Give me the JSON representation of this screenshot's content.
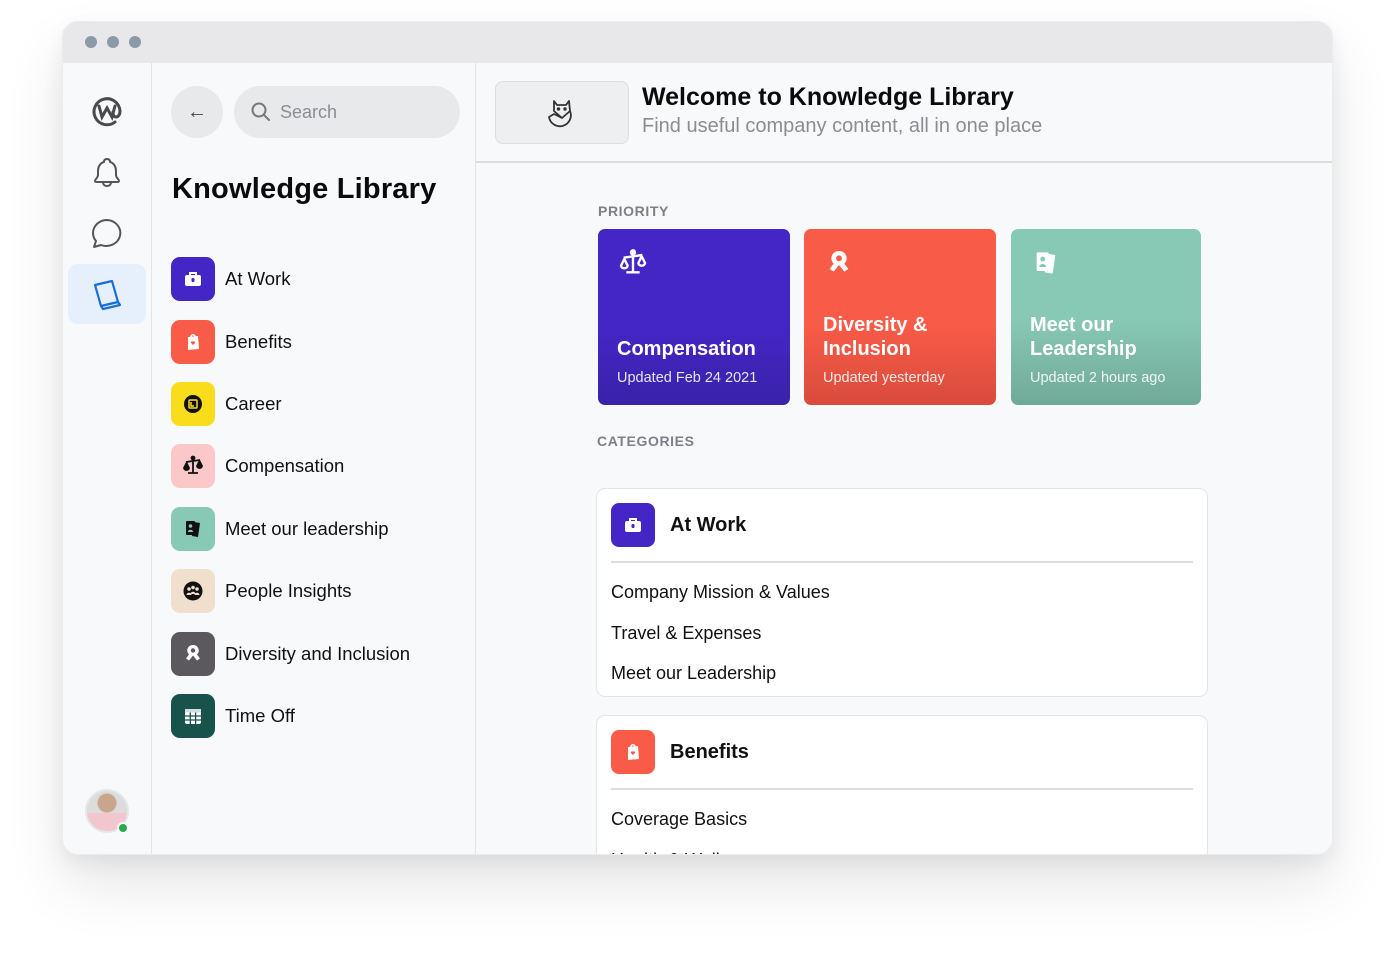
{
  "window": {
    "controls": [
      "close",
      "minimize",
      "maximize"
    ]
  },
  "rail": {
    "items": [
      {
        "name": "workplace-logo",
        "icon": "workplace-icon",
        "active": false
      },
      {
        "name": "notifications",
        "icon": "bell-icon",
        "active": false
      },
      {
        "name": "chats",
        "icon": "chat-bubble-icon",
        "active": false
      },
      {
        "name": "knowledge-library",
        "icon": "book-icon",
        "active": true
      }
    ],
    "user": {
      "presence": "online"
    }
  },
  "panel": {
    "back_icon": "←",
    "search": {
      "placeholder": "Search",
      "value": ""
    },
    "title": "Knowledge Library",
    "items": [
      {
        "label": "At Work",
        "icon": "briefcase-icon",
        "color": "#4426c6"
      },
      {
        "label": "Benefits",
        "icon": "shopping-bag-heart-icon",
        "color": "#f85b48"
      },
      {
        "label": "Career",
        "icon": "career-badge-icon",
        "color": "#f9dc1c"
      },
      {
        "label": "Compensation",
        "icon": "scales-icon",
        "color": "#fbc7c8"
      },
      {
        "label": "Meet our leadership",
        "icon": "id-cards-icon",
        "color": "#88c9b5"
      },
      {
        "label": "People Insights",
        "icon": "people-group-icon",
        "color": "#f1dfcd"
      },
      {
        "label": "Diversity and Inclusion",
        "icon": "ribbon-icon",
        "color": "#5b585e"
      },
      {
        "label": "Time Off",
        "icon": "calendar-icon",
        "color": "#17524b"
      }
    ]
  },
  "header": {
    "title": "Welcome to Knowledge Library",
    "subtitle": "Find useful company content, all in one place",
    "logo_icon": "fox-icon"
  },
  "priority": {
    "label": "PRIORITY",
    "cards": [
      {
        "title": "Compensation",
        "updated": "Updated Feb 24 2021",
        "icon": "scales-icon",
        "color": "#4426c6"
      },
      {
        "title": "Diversity & Inclusion",
        "updated": "Updated yesterday",
        "icon": "ribbon-icon",
        "color": "#f85b48"
      },
      {
        "title": "Meet our Leadership",
        "updated": "Updated 2 hours ago",
        "icon": "id-cards-icon",
        "color": "#88c9b5"
      }
    ]
  },
  "categories": {
    "label": "CATEGORIES",
    "cards": [
      {
        "title": "At Work",
        "icon": "briefcase-icon",
        "color": "#4426c6",
        "links": [
          "Company Mission & Values",
          "Travel & Expenses",
          "Meet our Leadership"
        ]
      },
      {
        "title": "Benefits",
        "icon": "shopping-bag-heart-icon",
        "color": "#f85b48",
        "links": [
          "Coverage Basics",
          "Health & Wellness"
        ]
      }
    ]
  }
}
